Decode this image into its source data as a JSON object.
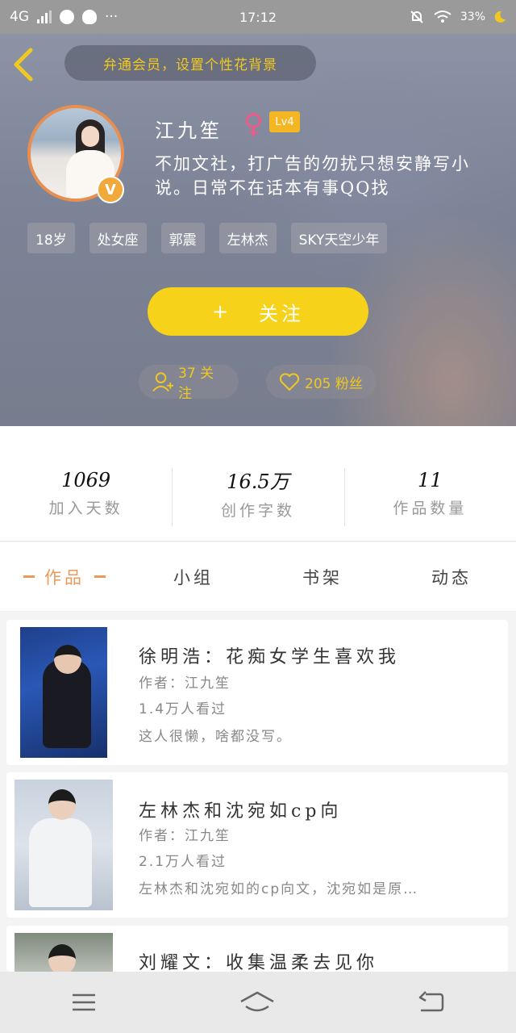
{
  "status_bar": {
    "network": "4G",
    "time": "17:12",
    "battery": "33%",
    "more": "···"
  },
  "header": {
    "bg_hint": "弁通会员，设置个性花背景"
  },
  "profile": {
    "name": "江九笙",
    "gender_symbol": "♀",
    "level": "Lv4",
    "verified": "V",
    "bio": "不加文社，打广告的勿扰只想安静写小说。日常不在话本有事QQ找",
    "tags": [
      "18岁",
      "处女座",
      "郭震",
      "左林杰",
      "SKY天空少年"
    ]
  },
  "follow_button": {
    "plus": "+",
    "label": "关注"
  },
  "counts": {
    "follow": "37 关注",
    "fans": "205 粉丝"
  },
  "stats": [
    {
      "value": "1069",
      "label": "加入天数"
    },
    {
      "value": "16.5万",
      "label": "创作字数"
    },
    {
      "value": "11",
      "label": "作品数量"
    }
  ],
  "tabs": [
    {
      "label": "作品"
    },
    {
      "label": "小组"
    },
    {
      "label": "书架"
    },
    {
      "label": "动态"
    }
  ],
  "books": [
    {
      "title": "徐明浩：花痴女学生喜欢我",
      "author": "作者：江九笙",
      "views": "1.4万人看过",
      "desc": "这人很懒，啥都没写。"
    },
    {
      "title": "左林杰和沈宛如cp向",
      "author": "作者：江九笙",
      "views": "2.1万人看过",
      "desc": "左林杰和沈宛如的cp向文，沈宛如是原…"
    },
    {
      "title": "刘耀文：收集温柔去见你",
      "author": "",
      "views": "",
      "desc": ""
    }
  ],
  "colors": {
    "accent_yellow": "#f6d21b",
    "active_tab": "#ea9a5a",
    "gender_pink": "#ef5a8a"
  }
}
